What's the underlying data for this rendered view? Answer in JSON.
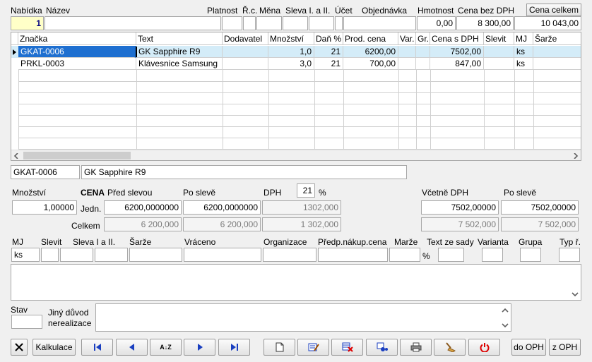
{
  "header": {
    "labels": {
      "nabidka": "Nabídka",
      "nazev": "Název",
      "platnost": "Platnost",
      "rc": "Ř.c.",
      "mena": "Měna",
      "sleva": "Sleva I. a II.",
      "ucet": "Účet",
      "objednavka": "Objednávka",
      "hmotnost": "Hmotnost",
      "cena_bez_dph": "Cena bez DPH",
      "cena_celkem": "Cena celkem"
    },
    "values": {
      "nabidka": "1",
      "nazev": "",
      "hmotnost": "0,00",
      "cena_bez_dph": "8 300,00",
      "cena_celkem": "10 043,00"
    }
  },
  "grid": {
    "columns": [
      "Značka",
      "Text",
      "Dodavatel",
      "Množství",
      "Daň %",
      "Prod. cena",
      "Var.",
      "Gr.",
      "Cena s DPH",
      "Slevit",
      "MJ",
      "Šarže"
    ],
    "rows": [
      {
        "znacka": "GKAT-0006",
        "text": "GK Sapphire R9",
        "dodavatel": "",
        "mnozstvi": "1,0",
        "dan": "21",
        "prod_cena": "6200,00",
        "var": "",
        "gr": "",
        "cena_s_dph": "7502,00",
        "slevit": "",
        "mj": "ks",
        "sarze": ""
      },
      {
        "znacka": "PRKL-0003",
        "text": "Klávesnice Samsung",
        "dodavatel": "",
        "mnozstvi": "3,0",
        "dan": "21",
        "prod_cena": "700,00",
        "var": "",
        "gr": "",
        "cena_s_dph": "847,00",
        "slevit": "",
        "mj": "ks",
        "sarze": ""
      }
    ]
  },
  "detail": {
    "code": "GKAT-0006",
    "name": "GK Sapphire R9",
    "labels": {
      "mnozstvi": "Množství",
      "cena": "CENA",
      "pred_slevou": "Před slevou",
      "po_sleve": "Po slevě",
      "dph": "DPH",
      "pct": "%",
      "vcetne_dph": "Včetně DPH",
      "po_sleve2": "Po slevě",
      "jedn": "Jedn.",
      "celkem": "Celkem"
    },
    "mnozstvi": "1,00000",
    "dph_rate": "21",
    "jedn": {
      "pred": "6200,0000000",
      "po": "6200,0000000",
      "dph": "1302,000",
      "vcetne": "7502,00000",
      "po2": "7502,00000"
    },
    "celkem": {
      "pred": "6 200,000",
      "po": "6 200,000",
      "dph": "1 302,000",
      "vcetne": "7 502,000",
      "po2": "7 502,000"
    }
  },
  "extra": {
    "labels": {
      "mj": "MJ",
      "slevit": "Slevit",
      "sleva": "Sleva I a II.",
      "sarze": "Šarže",
      "vraceno": "Vráceno",
      "organizace": "Organizace",
      "predp": "Předp.nákup.cena",
      "marze": "Marže",
      "pct": "%",
      "text_ze_sady": "Text ze sady",
      "varianta": "Varianta",
      "grupa": "Grupa",
      "typ": "Typ ř."
    },
    "mj": "ks"
  },
  "status": {
    "stav_label": "Stav",
    "jiny_label1": "Jiný důvod",
    "jiny_label2": "nerealizace"
  },
  "toolbar": {
    "kalkulace": "Kalkulace",
    "sort": "A↓Z",
    "do_oph": "do OPH",
    "z_oph": "z OPH"
  }
}
